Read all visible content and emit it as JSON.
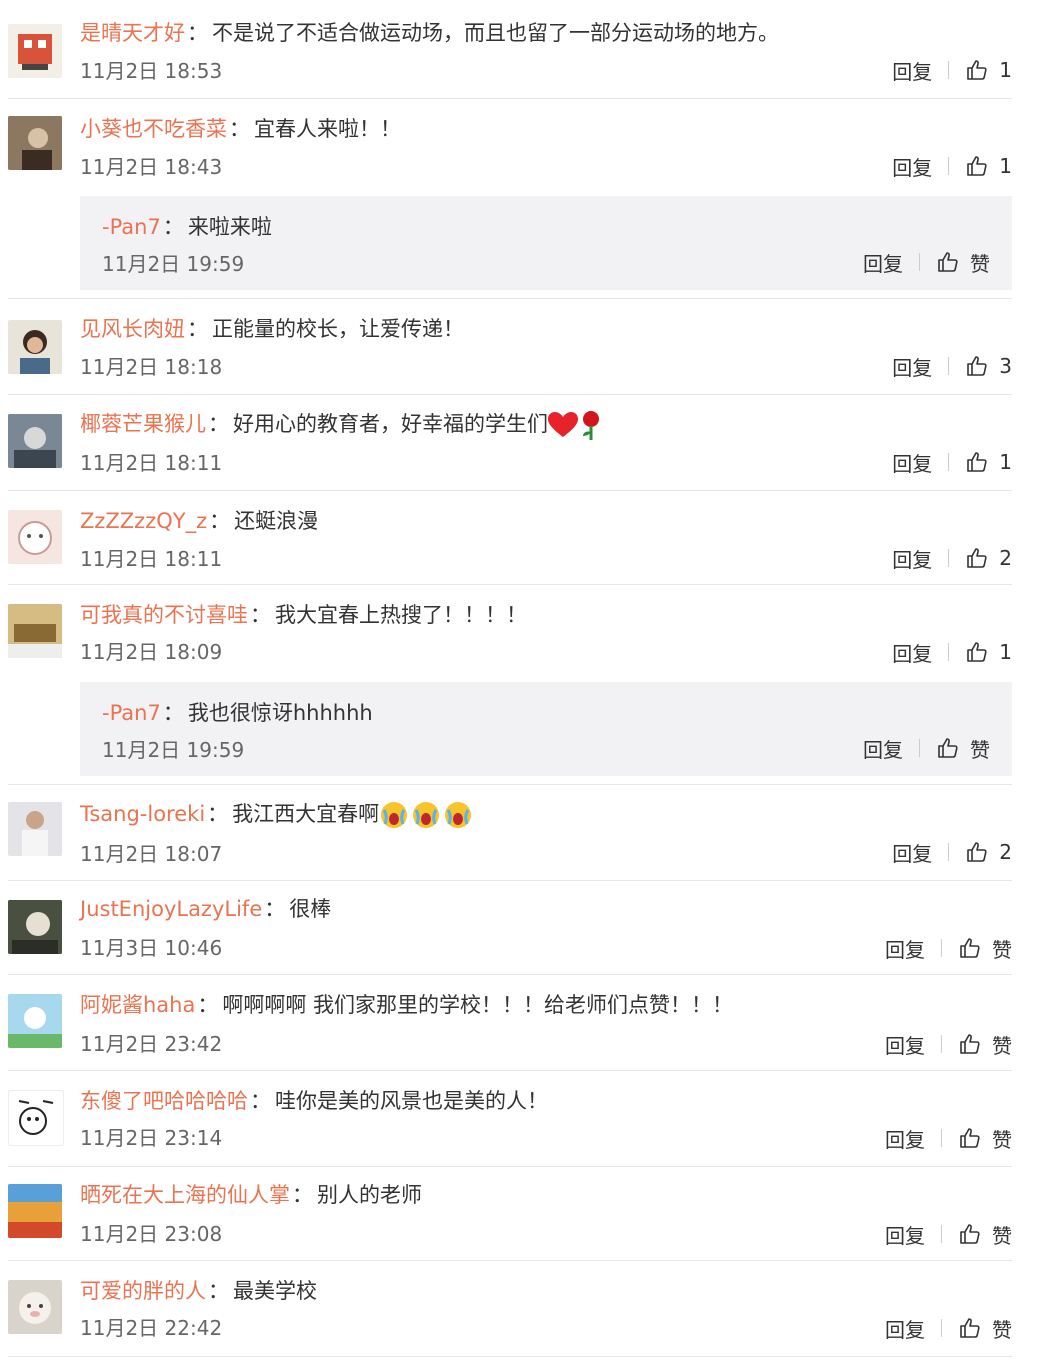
{
  "comments": [
    {
      "name": "是晴天才好",
      "text": "不是说了不适合做运动场，而且也留了一部分运动场的地方。",
      "time": "11月2日 18:53",
      "reply": "回复",
      "likes": "1"
    },
    {
      "name": "小葵也不吃香菜",
      "text": "宜春人来啦！！",
      "time": "11月2日 18:43",
      "reply": "回复",
      "likes": "1",
      "sub": {
        "name": "-Pan7",
        "text": "来啦来啦",
        "time": "11月2日 19:59",
        "reply": "回复",
        "likes": "赞"
      }
    },
    {
      "name": "见风长肉妞",
      "text": "正能量的校长，让爱传递！",
      "time": "11月2日 18:18",
      "reply": "回复",
      "likes": "3"
    },
    {
      "name": "椰蓉芒果猴儿",
      "text": "好用心的教育者，好幸福的学生们",
      "time": "11月2日 18:11",
      "reply": "回复",
      "likes": "1"
    },
    {
      "name": "ZzZZzzQY_z",
      "text": "还蜓浪漫",
      "time": "11月2日 18:11",
      "reply": "回复",
      "likes": "2"
    },
    {
      "name": "可我真的不讨喜哇",
      "text": "我大宜春上热搜了！！！！",
      "time": "11月2日 18:09",
      "reply": "回复",
      "likes": "1",
      "sub": {
        "name": "-Pan7",
        "text": "我也很惊讶hhhhhh",
        "time": "11月2日 19:59",
        "reply": "回复",
        "likes": "赞"
      }
    },
    {
      "name": "Tsang-loreki",
      "text": "我江西大宜春啊",
      "time": "11月2日 18:07",
      "reply": "回复",
      "likes": "2"
    },
    {
      "name": "JustEnjoyLazyLife",
      "text": "很棒",
      "time": "11月3日 10:46",
      "reply": "回复",
      "likes": "赞"
    },
    {
      "name": "阿妮酱haha",
      "text": "啊啊啊啊 我们家那里的学校！！！给老师们点赞！！！",
      "time": "11月2日 23:42",
      "reply": "回复",
      "likes": "赞"
    },
    {
      "name": "东傻了吧哈哈哈哈",
      "text": "哇你是美的风景也是美的人！",
      "time": "11月2日 23:14",
      "reply": "回复",
      "likes": "赞"
    },
    {
      "name": "晒死在大上海的仙人掌",
      "text": "别人的老师",
      "time": "11月2日 23:08",
      "reply": "回复",
      "likes": "赞"
    },
    {
      "name": "可爱的胖的人",
      "text": "最美学校",
      "time": "11月2日 22:42",
      "reply": "回复",
      "likes": "赞"
    }
  ],
  "separator": "：",
  "colors": {
    "username": "#eb7350",
    "text": "#333333",
    "time": "#666666",
    "reply_bg": "#f2f2f5",
    "divider": "#e6e6e6"
  }
}
